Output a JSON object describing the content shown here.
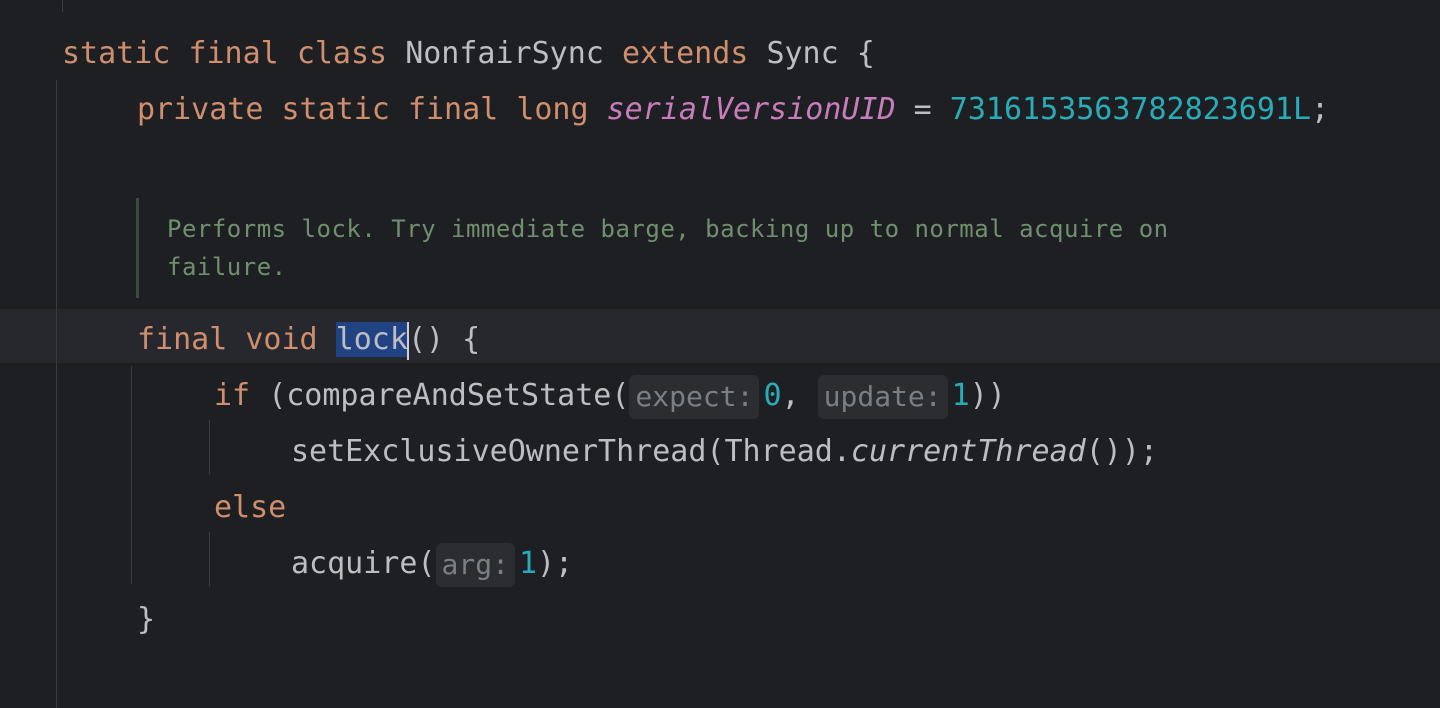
{
  "code": {
    "class_decl": {
      "kw1": "static",
      "kw2": "final",
      "kw3": "class",
      "name": "NonfairSync",
      "kw4": "extends",
      "parent": "Sync",
      "brace": "{"
    },
    "field_decl": {
      "kw1": "private",
      "kw2": "static",
      "kw3": "final",
      "kw4": "long",
      "name": "serialVersionUID",
      "eq": "=",
      "value": "7316153563782823691L",
      "semi": ";"
    },
    "doc_comment": "Performs lock. Try immediate barge, backing up to normal acquire on failure.",
    "method_decl": {
      "kw1": "final",
      "kw2": "void",
      "name": "lock",
      "rest": "() {"
    },
    "if_line": {
      "kw": "if",
      "open": "(compareAndSetState(",
      "hint1": "expect:",
      "arg1": "0",
      "comma": ",",
      "hint2": "update:",
      "arg2": "1",
      "close": "))"
    },
    "set_line": {
      "call": "setExclusiveOwnerThread(Thread.",
      "italic": "currentThread",
      "end": "());"
    },
    "else_line": {
      "kw": "else"
    },
    "acquire_line": {
      "call": "acquire(",
      "hint": "arg:",
      "arg": "1",
      "end": ");"
    },
    "close_brace": "}"
  },
  "colors": {
    "background": "#1e1f22",
    "keyword": "#cf8e6d",
    "field": "#c77dbb",
    "number": "#2aacb8",
    "selection": "#214283",
    "comment": "#6f8f6f"
  }
}
